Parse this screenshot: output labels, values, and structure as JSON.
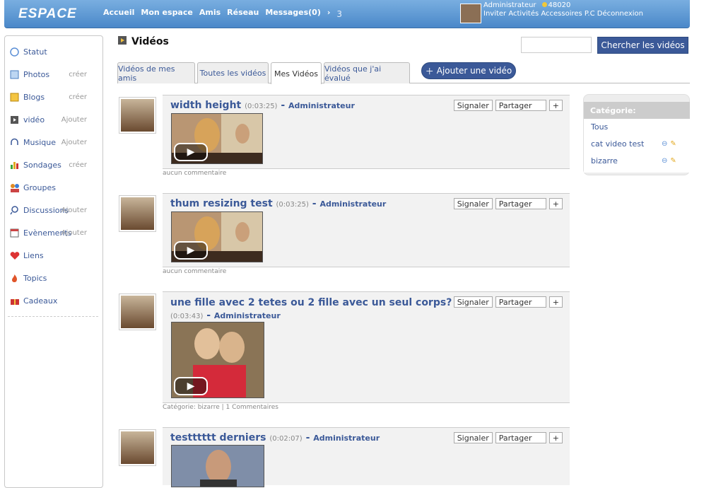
{
  "header": {
    "logo": "ESPACE",
    "nav": [
      "Accueil",
      "Mon espace",
      "Amis",
      "Réseau",
      "Messages(0)"
    ],
    "nav_arrow": "›",
    "nav_count": "3",
    "user_name": "Administrateur",
    "points": "48020",
    "user_links": "Inviter Activités Accessoires P.C Déconnexion"
  },
  "sidebar": {
    "items": [
      {
        "label": "Statut",
        "action": "",
        "icon": "status-icon",
        "color": "#5b8fd6"
      },
      {
        "label": "Photos",
        "action": "créer",
        "icon": "photos-icon",
        "color": "#6aa5dc"
      },
      {
        "label": "Blogs",
        "action": "créer",
        "icon": "blogs-icon",
        "color": "#e3a922"
      },
      {
        "label": "vidéo",
        "action": "Ajouter",
        "icon": "video-icon",
        "color": "#555555"
      },
      {
        "label": "Musique",
        "action": "Ajouter",
        "icon": "music-icon",
        "color": "#3b5998"
      },
      {
        "label": "Sondages",
        "action": "créer",
        "icon": "polls-icon",
        "color": "#3aa33a"
      },
      {
        "label": "Groupes",
        "action": "",
        "icon": "groups-icon",
        "color": "#e08a24"
      },
      {
        "label": "Discussions",
        "action": "Ajouter",
        "icon": "discussions-icon",
        "color": "#3b5998"
      },
      {
        "label": "Evènements",
        "action": "Ajouter",
        "icon": "events-icon",
        "color": "#c44"
      },
      {
        "label": "Liens",
        "action": "",
        "icon": "links-icon",
        "color": "#d33"
      },
      {
        "label": "Topics",
        "action": "",
        "icon": "topics-icon",
        "color": "#e0552a"
      },
      {
        "label": "Cadeaux",
        "action": "",
        "icon": "gifts-icon",
        "color": "#c33"
      }
    ]
  },
  "page": {
    "title": "Vidéos",
    "search_placeholder": "",
    "search_button": "Chercher les vidéos",
    "tabs": [
      "Vidéos de mes amis",
      "Toutes les vidéos",
      "Mes Vidéos",
      "Vidéos que j'ai évalué"
    ],
    "active_tab": "Mes Vidéos",
    "add_button": "Ajouter une vidéo"
  },
  "videos": [
    {
      "title": "width height",
      "duration": "(0:03:25)",
      "sep": " - ",
      "author": "Administrateur",
      "report": "Signaler",
      "share": "Partager",
      "plus": "+",
      "footer": "aucun commentaire"
    },
    {
      "title": "thum resizing test",
      "duration": "(0:03:25)",
      "sep": " - ",
      "author": "Administrateur",
      "report": "Signaler",
      "share": "Partager",
      "plus": "+",
      "footer": "aucun commentaire"
    },
    {
      "title": "une fille avec 2 tetes ou 2 fille avec un seul corps?",
      "duration": "(0:03:43)",
      "sep": " - ",
      "author": "Administrateur",
      "report": "Signaler",
      "share": "Partager",
      "plus": "+",
      "footer": "Catégorie: bizarre  |  1 Commentaires"
    },
    {
      "title": "testttttt derniers",
      "duration": "(0:02:07)",
      "sep": " - ",
      "author": "Administrateur",
      "report": "Signaler",
      "share": "Partager",
      "plus": "+",
      "footer": ""
    }
  ],
  "categories": {
    "heading": "Catégorie:",
    "items": [
      "Tous",
      "cat video test",
      "bizarre"
    ]
  },
  "colors": {
    "accent": "#3b5998",
    "header": "#4a88c9"
  }
}
